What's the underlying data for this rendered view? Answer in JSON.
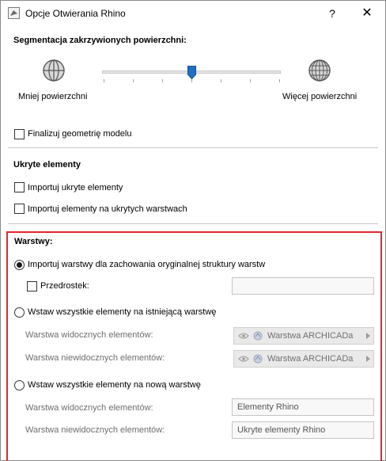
{
  "window": {
    "title": "Opcje Otwierania Rhino",
    "help_label": "?",
    "close_label": "✕"
  },
  "segmentation": {
    "title": "Segmentacja zakrzywionych powierzchni:",
    "less_label": "Mniej powierzchni",
    "more_label": "Więcej powierzchni",
    "level": 0.5
  },
  "finalize": {
    "label": "Finalizuj geometrię modelu",
    "checked": false
  },
  "hidden_elements": {
    "title": "Ukryte elementy",
    "import_hidden_label": "Importuj ukryte elementy",
    "import_hidden_checked": false,
    "import_on_hidden_layers_label": "Importuj elementy na ukrytych warstwach",
    "import_on_hidden_layers_checked": false
  },
  "layers": {
    "title": "Warstwy:",
    "option1_label": "Importuj warstwy dla zachowania oryginalnej struktury warstw",
    "option1_selected": true,
    "prefix_label": "Przedrostek:",
    "prefix_checked": false,
    "prefix_value": "",
    "option2_label": "Wstaw wszystkie elementy na istniejącą warstwę",
    "option2_selected": false,
    "option2_visible_label": "Warstwa widocznych elementów:",
    "option2_visible_value": "Warstwa ARCHICADa",
    "option2_invisible_label": "Warstwa niewidocznych elementów:",
    "option2_invisible_value": "Warstwa ARCHICADa",
    "option3_label": "Wstaw wszystkie elementy na nową warstwę",
    "option3_selected": false,
    "option3_visible_label": "Warstwa widocznych elementów:",
    "option3_visible_value": "Elementy Rhino",
    "option3_invisible_label": "Warstwa niewidocznych elementów:",
    "option3_invisible_value": "Ukryte elementy Rhino"
  },
  "colors": {
    "highlight": "#e4262b",
    "slider_thumb": "#1f6fc5"
  },
  "icons": {
    "app": "rhino-app-icon",
    "globe": "globe-icon",
    "eye": "eye-icon",
    "layer": "layer-icon"
  }
}
